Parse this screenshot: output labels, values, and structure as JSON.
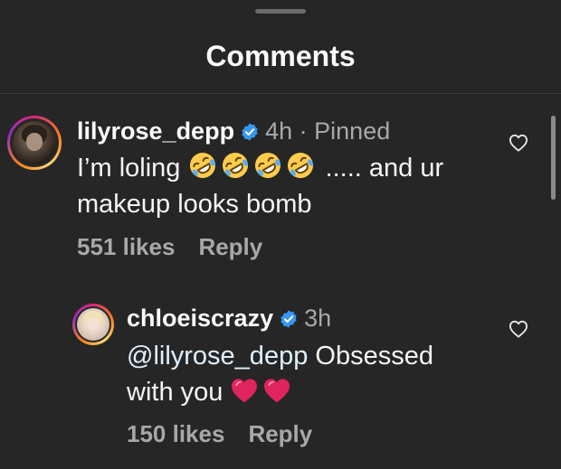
{
  "sheet": {
    "title": "Comments"
  },
  "comments": [
    {
      "username": "lilyrose_depp",
      "time": "4h",
      "separator": "·",
      "pinned_label": "Pinned",
      "line1_text": "I’m loling",
      "emoji_icon": "rolling-on-floor-laughing-emoji",
      "emoji_count": 4,
      "line1_suffix": "..... and ur",
      "line2_text": "makeup looks bomb",
      "likes": "551 likes",
      "reply_label": "Reply"
    },
    {
      "username": "chloeiscrazy",
      "time": "3h",
      "mention": "@lilyrose_depp",
      "line1_text": " Obsessed",
      "line2_text": "with you",
      "emoji_icon": "red-heart-emoji",
      "emoji_count": 2,
      "likes": "150 likes",
      "reply_label": "Reply"
    }
  ],
  "colors": {
    "background": "#262626",
    "verified_badge": "#3897f0",
    "secondary_text": "#a8a8a8",
    "heart_emoji": "#e0245e"
  }
}
